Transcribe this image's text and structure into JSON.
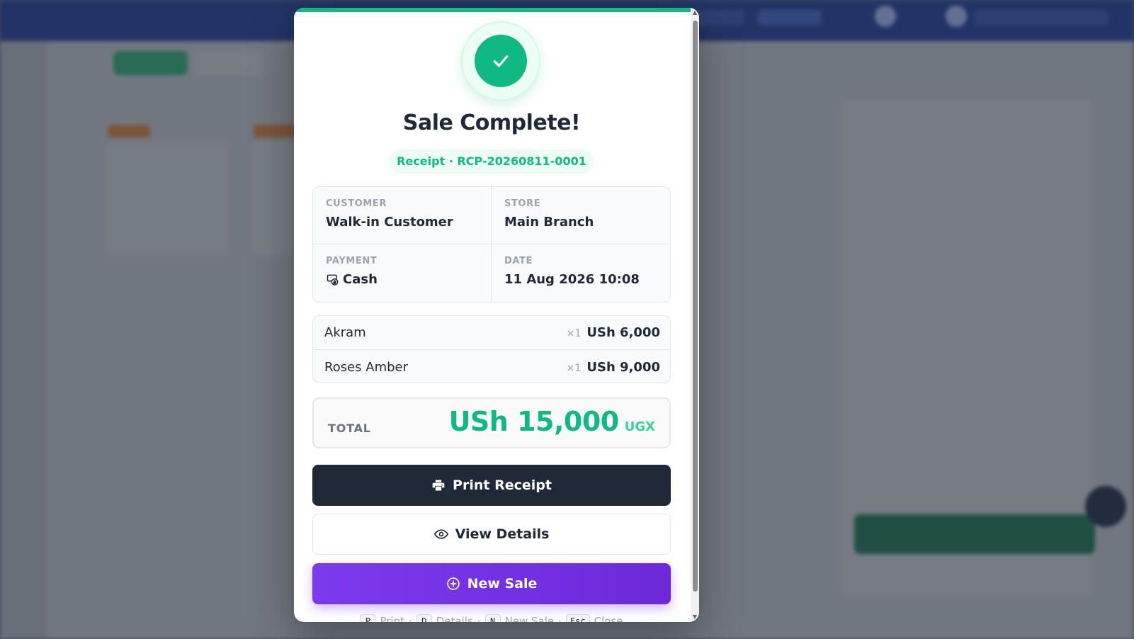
{
  "modal": {
    "title": "Sale Complete!",
    "receipt_badge": "Receipt · RCP-20260811-0001",
    "info": {
      "customer_label": "CUSTOMER",
      "customer_value": "Walk-in Customer",
      "store_label": "STORE",
      "store_value": "Main Branch",
      "payment_label": "PAYMENT",
      "payment_value": "Cash",
      "payment_icon": "cash-icon",
      "date_label": "DATE",
      "date_value": "11 Aug 2026 10:08"
    },
    "items": [
      {
        "name": "Akram",
        "qty": "×1",
        "price": "USh 6,000"
      },
      {
        "name": "Roses Amber",
        "qty": "×1",
        "price": "USh 9,000"
      }
    ],
    "total": {
      "label": "TOTAL",
      "amount": "USh 15,000",
      "currency": "UGX"
    },
    "buttons": {
      "print": "Print Receipt",
      "details": "View Details",
      "new_sale": "New Sale"
    },
    "shortcuts": [
      {
        "key": "P",
        "label": "Print"
      },
      {
        "key": "D",
        "label": "Details"
      },
      {
        "key": "N",
        "label": "New Sale"
      },
      {
        "key": "Esc",
        "label": "Close"
      }
    ],
    "colors": {
      "success": "#10b981",
      "primary_dark": "#1f2937",
      "accent_purple": "#7c3aed"
    }
  }
}
